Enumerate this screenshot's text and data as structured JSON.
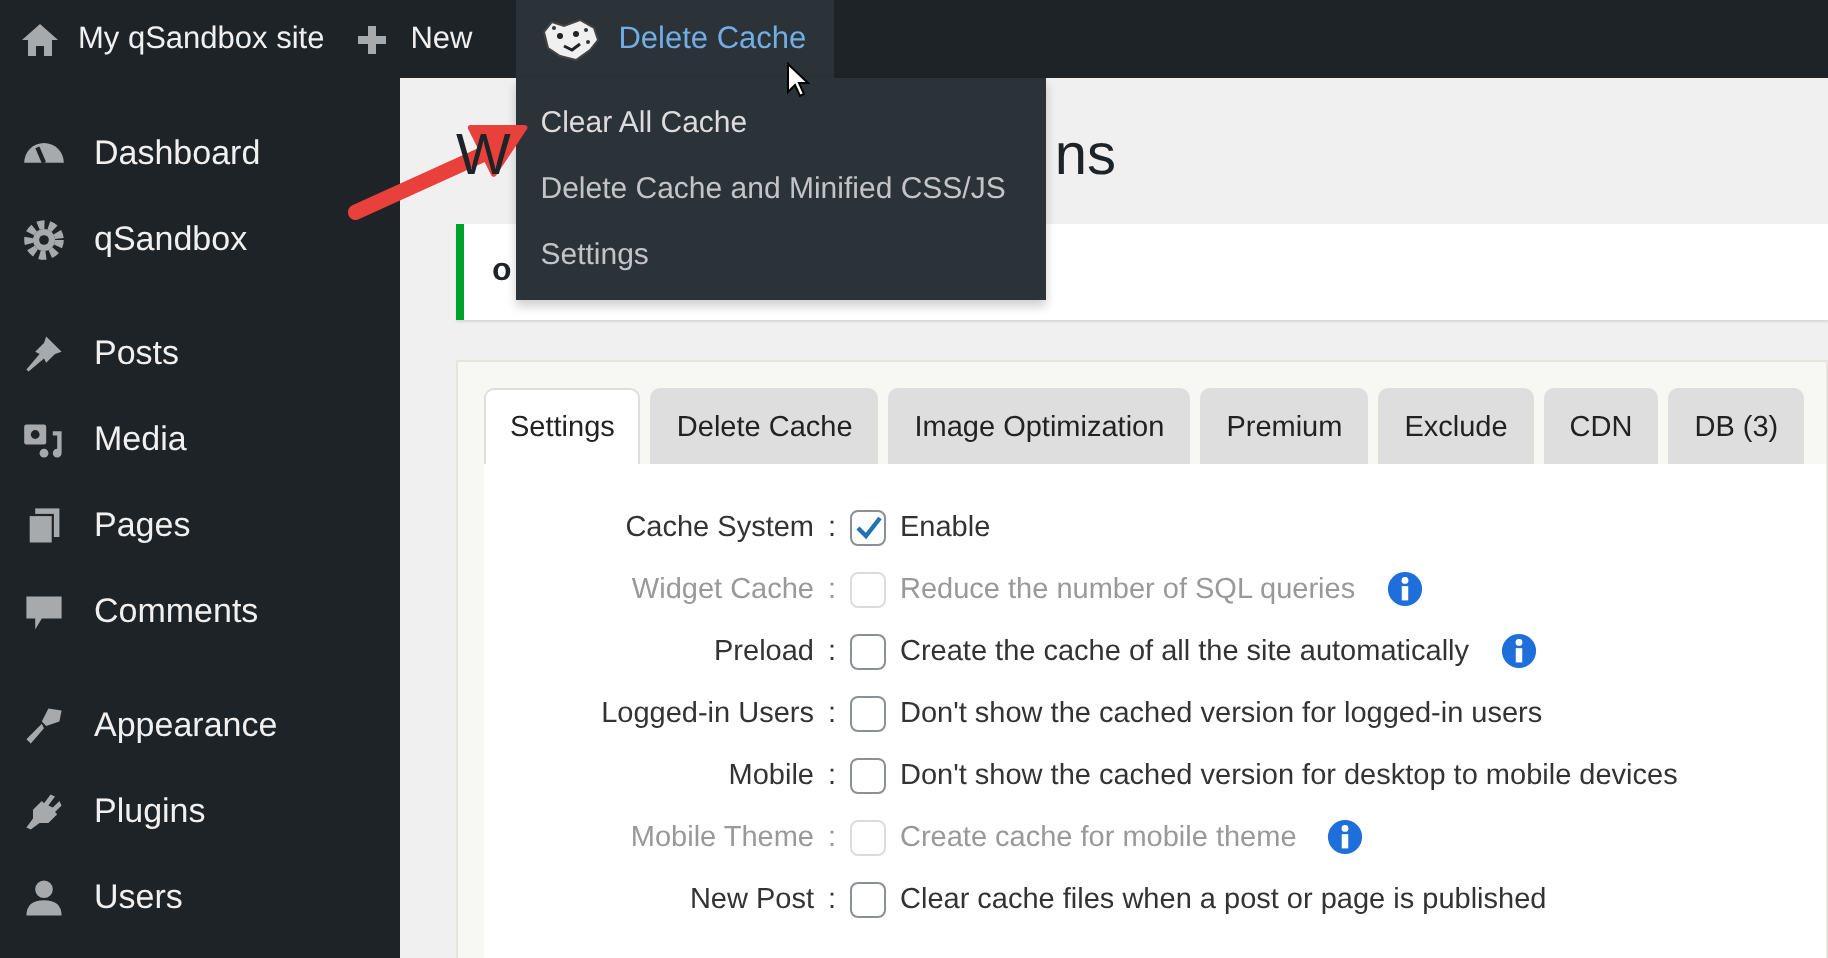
{
  "admin_bar": {
    "items": [
      {
        "kind": "home",
        "label": "My qSandbox site"
      },
      {
        "kind": "new",
        "label": "New"
      },
      {
        "kind": "cache",
        "label": "Delete Cache",
        "open": true
      }
    ]
  },
  "dropdown": {
    "items": [
      {
        "label": "Clear All Cache",
        "highlighted": true
      },
      {
        "label": "Delete Cache and Minified CSS/JS",
        "highlighted": false
      },
      {
        "label": "Settings",
        "highlighted": false
      }
    ]
  },
  "sidebar": {
    "groups": [
      [
        {
          "kind": "dashboard",
          "label": "Dashboard"
        },
        {
          "kind": "gear",
          "label": "qSandbox"
        }
      ],
      [
        {
          "kind": "pin",
          "label": "Posts"
        },
        {
          "kind": "media",
          "label": "Media"
        },
        {
          "kind": "pages",
          "label": "Pages"
        },
        {
          "kind": "comment",
          "label": "Comments"
        }
      ],
      [
        {
          "kind": "brush",
          "label": "Appearance"
        },
        {
          "kind": "plug",
          "label": "Plugins"
        },
        {
          "kind": "user",
          "label": "Users"
        }
      ]
    ]
  },
  "heading": {
    "left": "W",
    "right": "ns"
  },
  "notice": {
    "text": "o"
  },
  "tabs": [
    {
      "label": "Settings",
      "selected": true
    },
    {
      "label": "Delete Cache",
      "selected": false
    },
    {
      "label": "Image Optimization",
      "selected": false
    },
    {
      "label": "Premium",
      "selected": false
    },
    {
      "label": "Exclude",
      "selected": false
    },
    {
      "label": "CDN",
      "selected": false
    },
    {
      "label": "DB (3)",
      "selected": false
    }
  ],
  "options": [
    {
      "label": "Cache System",
      "separator": ":",
      "text": "Enable",
      "checked": true,
      "disabled": false
    },
    {
      "label": "Widget Cache",
      "separator": ":",
      "text": "Reduce the number of SQL queries",
      "checked": false,
      "disabled": true,
      "info": true
    },
    {
      "label": "Preload",
      "separator": ":",
      "text": "Create the cache of all the site automatically",
      "checked": false,
      "disabled": false,
      "info": true
    },
    {
      "label": "Logged-in Users",
      "separator": ":",
      "text": "Don't show the cached version for logged-in users",
      "checked": false,
      "disabled": false
    },
    {
      "label": "Mobile",
      "separator": ":",
      "text": "Don't show the cached version for desktop to mobile devices",
      "checked": false,
      "disabled": false
    },
    {
      "label": "Mobile Theme",
      "separator": ":",
      "text": "Create cache for mobile theme",
      "checked": false,
      "disabled": true,
      "info": true
    },
    {
      "label": "New Post",
      "separator": ":",
      "text": "Clear cache files when a post or page is published",
      "checked": false,
      "disabled": false
    }
  ]
}
